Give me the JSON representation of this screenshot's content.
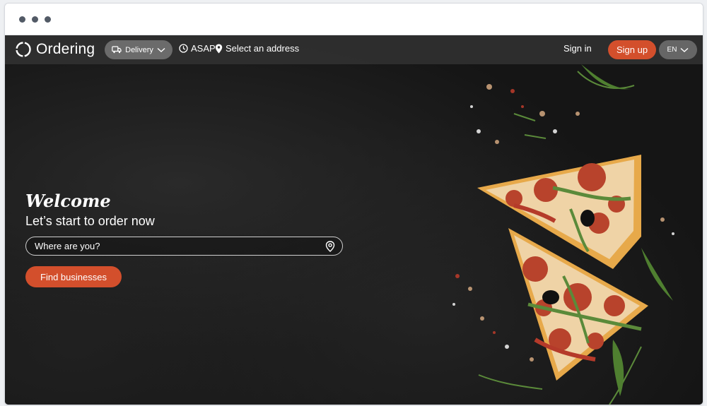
{
  "app": {
    "brand": "Ordering",
    "delivery_label": "Delivery",
    "asap_label": "ASAP",
    "address_label": "Select an address",
    "signin_label": "Sign in",
    "signup_label": "Sign up",
    "language_label": "EN"
  },
  "hero": {
    "welcome": "Welcome",
    "subtitle": "Let’s start to order now",
    "search_placeholder": "Where are you?",
    "find_label": "Find businesses"
  },
  "colors": {
    "accent": "#d34f2c",
    "topbar": "#303030",
    "background": "#151515"
  },
  "icons": [
    "logo-ring-icon",
    "truck-icon",
    "chevron-down-icon",
    "clock-icon",
    "map-pin-icon",
    "location-pin-icon"
  ]
}
